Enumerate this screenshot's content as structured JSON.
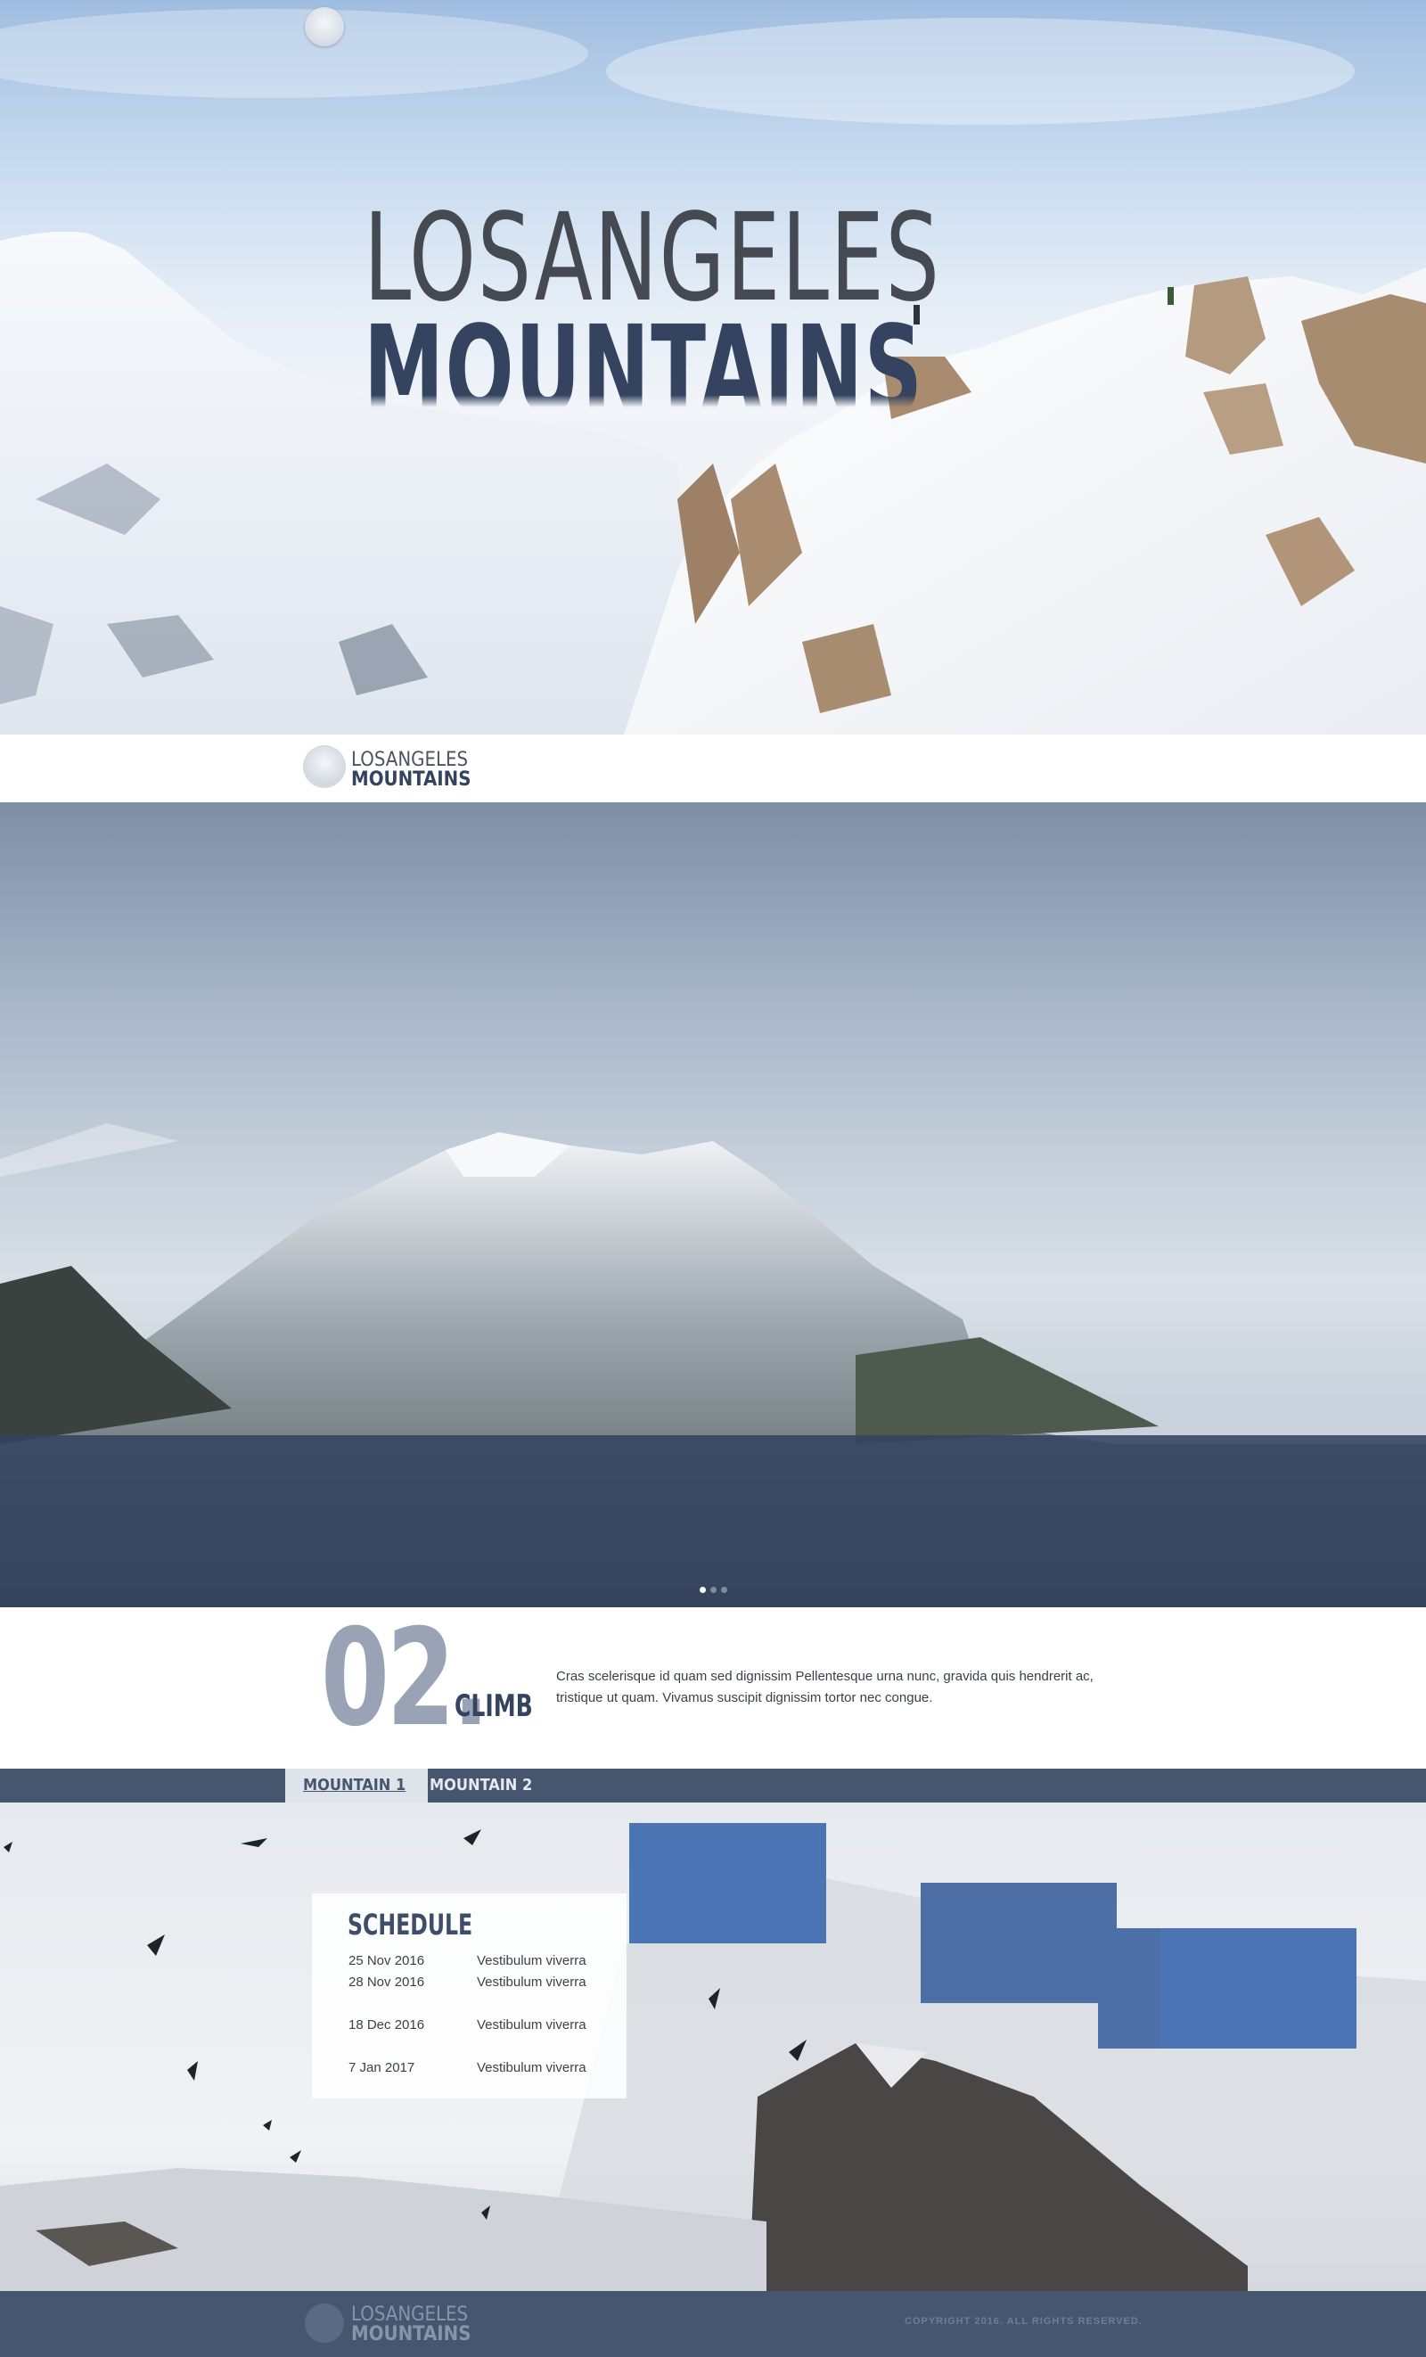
{
  "hero": {
    "title_line1": "LOSANGELES",
    "title_line2": "MOUNTAINS"
  },
  "brand": {
    "line1": "LOSANGELES",
    "line2": "MOUNTAINS"
  },
  "slider": {
    "dots": 3,
    "active_dot": 1
  },
  "climb": {
    "number": "02.",
    "title": "CLIMB",
    "text": "Cras scelerisque id quam sed dignissim Pellentesque urna nunc, gravida quis hendrerit ac, tristique ut quam. Vivamus suscipit dignissim tortor nec congue."
  },
  "tabs": [
    {
      "label": "MOUNTAIN 1",
      "active": true
    },
    {
      "label": "MOUNTAIN 2",
      "active": false
    }
  ],
  "schedule": {
    "title": "SCHEDULE",
    "rows": [
      {
        "date": "25 Nov 2016",
        "desc": "Vestibulum viverra"
      },
      {
        "date": "28 Nov 2016",
        "desc": "Vestibulum viverra"
      },
      {
        "date": "18 Dec 2016",
        "desc": "Vestibulum viverra"
      },
      {
        "date": "7 Jan 2017",
        "desc": "Vestibulum viverra"
      }
    ]
  },
  "footer": {
    "line1": "LOSANGELES",
    "line2": "MOUNTAINS",
    "copyright": "COPYRIGHT 2016. ALL RIGHTS RESERVED."
  },
  "colors": {
    "navy": "#46566f",
    "accent_blue": "#4a74b4",
    "title_dark": "#34435f"
  }
}
